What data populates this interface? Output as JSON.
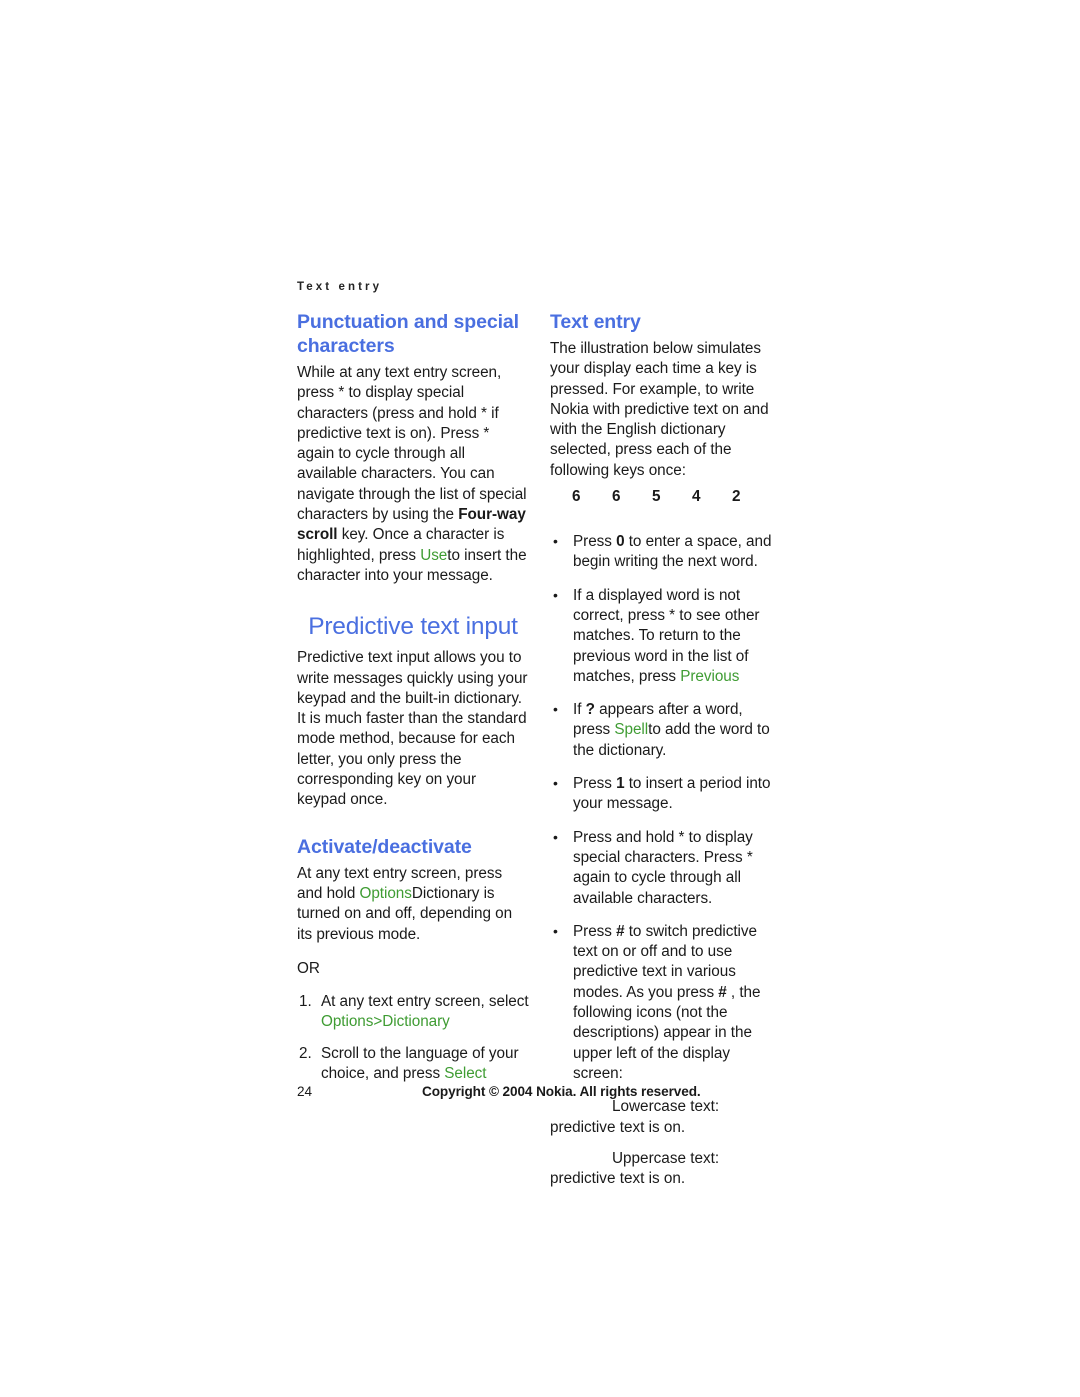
{
  "document": {
    "running_header": "Text entry",
    "page_number": "24",
    "copyright": "Copyright © 2004 Nokia. All rights reserved.",
    "accent_blue": "#4a6fe0",
    "accent_green": "#3f9c33"
  },
  "left_column": {
    "section1": {
      "heading": "Punctuation and special characters",
      "para_p1": "While at any text entry screen, press * to display special characters (press and hold * if predictive text is on). Press * again to cycle through all available characters. You can navigate through the list of special characters by using the ",
      "para_p1_bold": "Four-way scroll",
      "para_p2": " key. Once a character is highlighted, press ",
      "para_p2_green": "Use",
      "para_p3": "to insert the character into your message."
    },
    "chapter_heading": "Predictive text input",
    "chapter_para": "Predictive text input allows you to write messages quickly using your keypad and the built-in dictionary. It is much faster than the standard mode method, because for each letter, you only press the corresponding key on your keypad once.",
    "section2": {
      "heading": "Activate/deactivate",
      "para_a1": "At any text entry screen, press and hold ",
      "para_a1_green": "Options",
      "para_a2": "Dictionary is turned on and off, depending on its previous mode.",
      "or_label": "OR",
      "steps": [
        {
          "text": "At any text entry screen, select ",
          "green": "Options",
          "green_sep": ">",
          "green2": "Dictionary",
          "tail": ""
        },
        {
          "text": "Scroll to the language of your choice, and press ",
          "green": "Select",
          "tail": ""
        }
      ]
    }
  },
  "right_column": {
    "heading": "Text entry",
    "intro": "The illustration below simulates your display each time a key is pressed. For example, to write Nokia with predictive text on and with the English dictionary selected, press each of the following keys once:",
    "key_sequence": [
      "6",
      "6",
      "5",
      "4",
      "2"
    ],
    "bullets": [
      {
        "pre": "Press ",
        "bold": "0",
        "post": " to enter a space, and begin writing the next word."
      },
      {
        "pre": "If a displayed word is not correct, press * to see other matches. To return to the previous word in the list of matches, press ",
        "green": "Previous",
        "post": ""
      },
      {
        "pre": "If ",
        "bold": "?",
        "mid": " appears after a word, press ",
        "green": "Spell",
        "post": "to add the word to the dictionary."
      },
      {
        "pre": "Press ",
        "bold": "1",
        "post": " to insert a period into your message."
      },
      {
        "pre": "Press and hold * to display special characters. Press * again to cycle through all available characters.",
        "post": ""
      },
      {
        "pre": "Press ",
        "bold": "#",
        "mid": " to switch predictive text on or off and to use predictive text in various modes. As you press ",
        "bold2": "#",
        "post": " , the following icons (not the descriptions) appear in the upper left of the display screen:"
      }
    ],
    "icon_lines": [
      {
        "label": "Lowercase text:",
        "desc": "predictive text is on."
      },
      {
        "label": "Uppercase text:",
        "desc": "predictive text is on."
      }
    ]
  }
}
